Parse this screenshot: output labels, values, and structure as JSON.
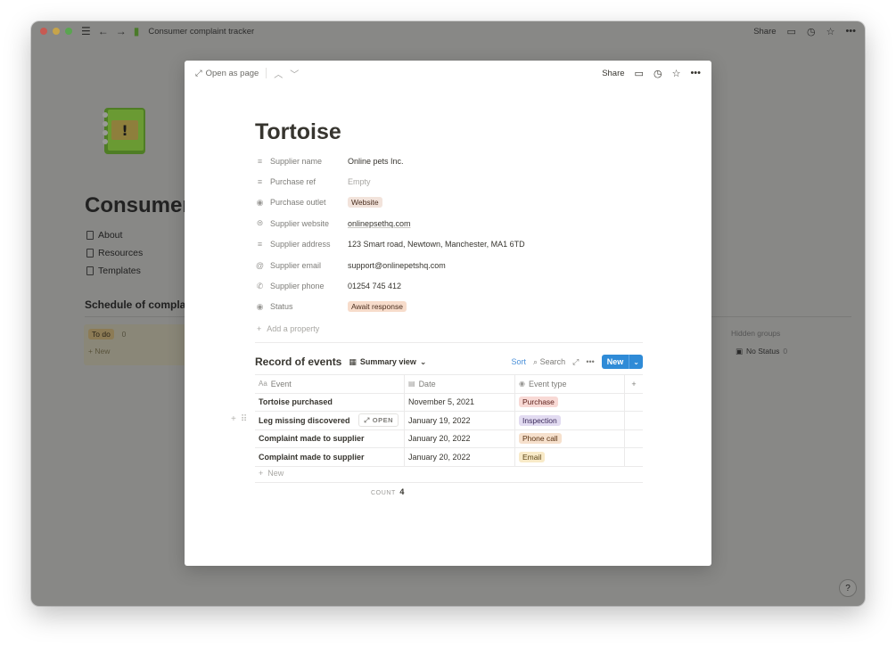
{
  "window": {
    "title": "Consumer complaint tracker",
    "share_label": "Share"
  },
  "background": {
    "page_title": "Consumer",
    "links": [
      "About",
      "Resources",
      "Templates"
    ],
    "schedule_heading": "Schedule of compla",
    "todo_label": "To do",
    "todo_count": "0",
    "new_label": "+ New",
    "hidden_groups_label": "Hidden groups",
    "no_status_label": "No Status",
    "no_status_count": "0",
    "help_label": "?"
  },
  "modal": {
    "open_as_page": "Open as page",
    "share_label": "Share",
    "title": "Tortoise",
    "properties": [
      {
        "name": "Supplier name",
        "value": "Online pets Inc."
      },
      {
        "name": "Purchase ref",
        "value": "Empty"
      },
      {
        "name": "Purchase outlet",
        "value": "Website"
      },
      {
        "name": "Supplier website",
        "value": "onlinepsethq.com"
      },
      {
        "name": "Supplier address",
        "value": "123 Smart road, Newtown, Manchester, MA1 6TD"
      },
      {
        "name": "Supplier email",
        "value": "support@onlinepetshq.com"
      },
      {
        "name": "Supplier phone",
        "value": "01254 745 412"
      },
      {
        "name": "Status",
        "value": "Await response"
      }
    ],
    "add_property": "Add a property"
  },
  "database": {
    "title": "Record of events",
    "view_label": "Summary view",
    "sort_label": "Sort",
    "search_label": "Search",
    "new_label": "New",
    "columns": [
      "Event",
      "Date",
      "Event type"
    ],
    "rows": [
      {
        "event": "Tortoise purchased",
        "date": "November 5, 2021",
        "type": "Purchase"
      },
      {
        "event": "Leg missing discovered",
        "date": "January 19, 2022",
        "type": "Inspection"
      },
      {
        "event": "Complaint made to supplier",
        "date": "January 20, 2022",
        "type": "Phone call"
      },
      {
        "event": "Complaint made to supplier",
        "date": "January 20, 2022",
        "type": "Email"
      }
    ],
    "open_label": "OPEN",
    "new_row_label": "New",
    "count_label": "COUNT",
    "count_value": "4"
  }
}
